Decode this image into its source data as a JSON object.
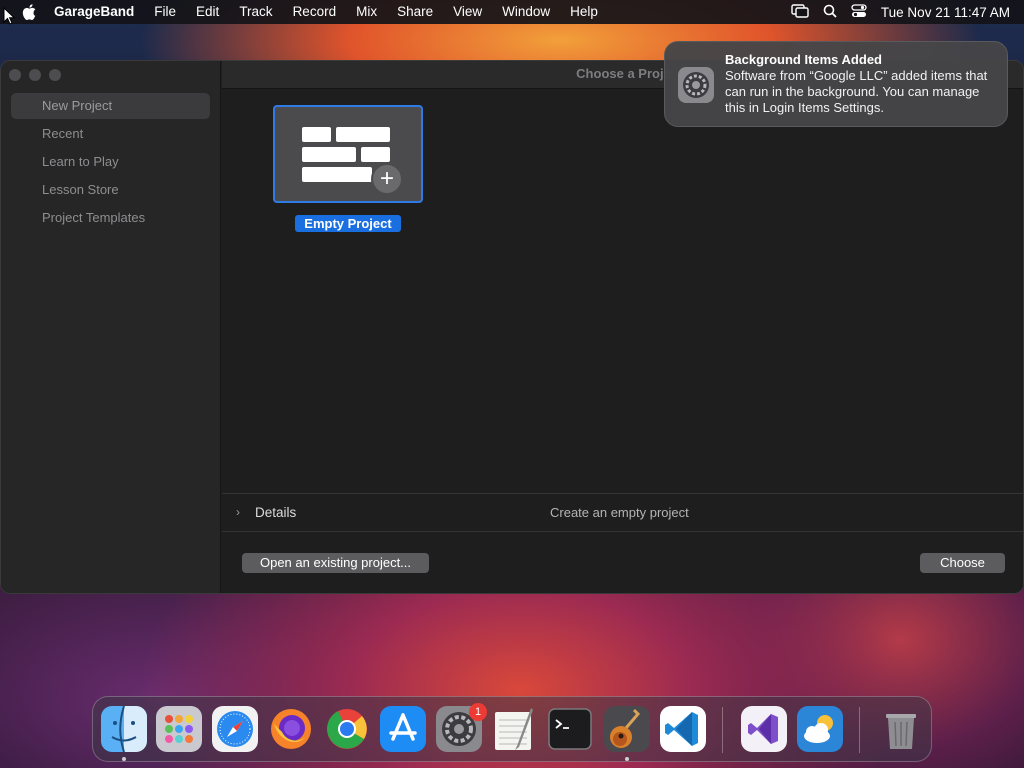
{
  "menubar": {
    "app_name": "GarageBand",
    "items": [
      "File",
      "Edit",
      "Track",
      "Record",
      "Mix",
      "Share",
      "View",
      "Window",
      "Help"
    ],
    "clock": "Tue Nov 21  11:47 AM"
  },
  "window": {
    "title": "Choose a Proje",
    "sidebar_items": [
      "New Project",
      "Recent",
      "Learn to Play",
      "Lesson Store",
      "Project Templates"
    ],
    "selected_sidebar_item": "New Project",
    "template_label": "Empty Project",
    "details_label": "Details",
    "details_description": "Create an empty project",
    "open_button": "Open an existing project...",
    "choose_button": "Choose"
  },
  "notification": {
    "title": "Background Items Added",
    "body": "Software from “Google LLC” added items that can run in the background. You can manage this in Login Items Settings."
  },
  "dock": {
    "apps": [
      "Finder",
      "Launchpad",
      "Safari",
      "Firefox",
      "Chrome",
      "App Store",
      "System Settings",
      "TextEdit",
      "Terminal",
      "GarageBand",
      "Visual Studio Code",
      "Visual Studio",
      "Weather",
      "Trash"
    ],
    "system_settings_badge": "1"
  },
  "colors": {
    "accent": "#1a6fe0",
    "window_bg": "#1e1e1e",
    "sidebar_bg": "#262627",
    "badge": "#ec3b35"
  }
}
